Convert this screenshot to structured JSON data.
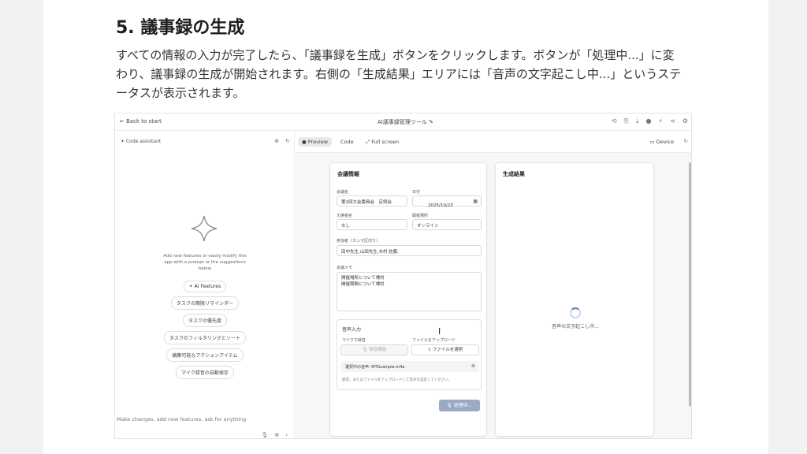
{
  "heading": "5. 議事録の生成",
  "description": "すべての情報の入力が完了したら、「議事録を生成」ボタンをクリックします。ボタンが「処理中...」に変わり、議事録の生成が開始されます。右側の「生成結果」エリアには「音声の文字起こし中...」というステータスが表示されます。",
  "topbar": {
    "back_label": "← Back to start",
    "app_title": "AI議事録管理ツール ✎"
  },
  "left_panel": {
    "assistant_label": "Code assistant",
    "helper_text": "Add new features or easily modify this app with a prompt or the suggestions below",
    "chips": [
      "AI Features",
      "タスクの期限リマインダー",
      "タスクの優先度",
      "タスクのフィルタリングとソート",
      "編集可能なアクションアイテム",
      "マイク録音の自動保存"
    ],
    "prompt_placeholder": "Make changes, add new features, ask for anything"
  },
  "preview_tabs": {
    "preview": "Preview",
    "code": "Code",
    "fullscreen": "Full screen",
    "device": "Device"
  },
  "form": {
    "title": "会議情報",
    "meeting_name_label": "会議名",
    "meeting_name": "第2回大会委員会　定例会",
    "date_label": "日付",
    "date": "2025/10/23",
    "attendee_label": "欠席者名",
    "attendee": "なし",
    "place_label": "開催場所",
    "place": "オンライン",
    "participants_label": "参加者（カンマ区切り）",
    "participants": "田中先生,山田先生,木村,佐藤,",
    "memo_label": "会議メモ",
    "memo": "開催場所について検討\n開催期間について検討",
    "voice": {
      "title": "音声入力",
      "mic_label": "マイクで録音",
      "upload_label": "ファイルをアップロード",
      "record_btn": "録音開始",
      "select_btn": "ファイルを選択",
      "selected_file": "選択中の音声: MTGsample.m4a",
      "note": "録音、またはファイルをアップロードして音声を設定してください。"
    },
    "submit_label": "処理中..."
  },
  "result": {
    "title": "生成結果",
    "status": "音声の文字起こし中..."
  }
}
